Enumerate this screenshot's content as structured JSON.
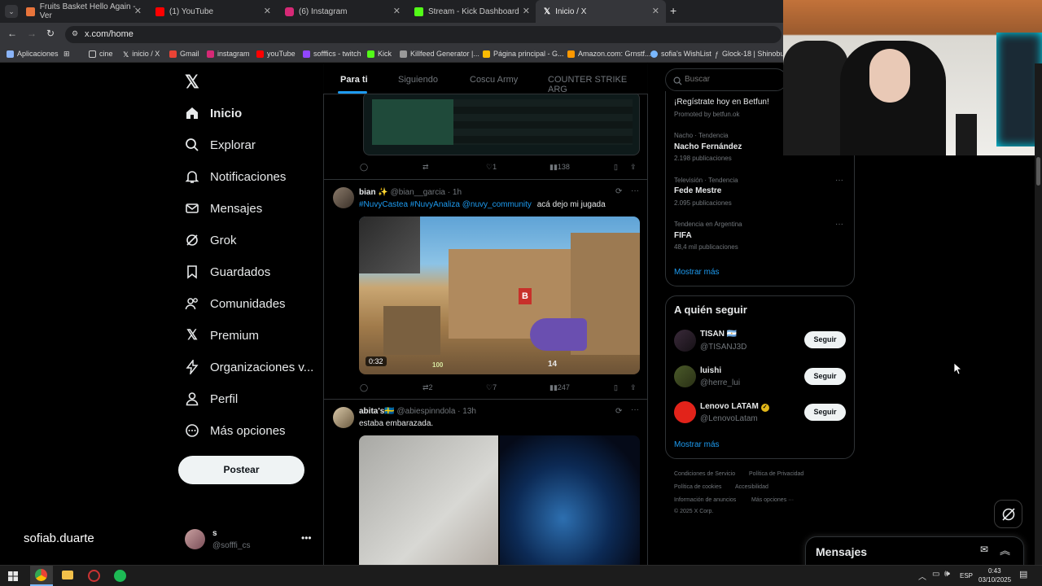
{
  "browser": {
    "tabs": [
      {
        "title": "Fruits Basket Hello Again - Ver",
        "color": "#e8743b"
      },
      {
        "title": "(1) YouTube",
        "color": "#ff0000"
      },
      {
        "title": "(6) Instagram",
        "color": "#d62976"
      },
      {
        "title": "Stream - Kick Dashboard",
        "color": "#53fc18"
      },
      {
        "title": "Inicio / X",
        "color": "#ffffff"
      }
    ],
    "url": "x.com/home",
    "bookmarks": [
      "Aplicaciones",
      "cine",
      "inicio / X",
      "Gmail",
      "instagram",
      "youTube",
      "sofffics - twitch",
      "Kick",
      "Killfeed Generator |...",
      "Página principal - G...",
      "Amazon.com: Grnstf...",
      "sofia's WishList",
      "Glock-18 | Shinobu..."
    ]
  },
  "sidebar": {
    "items": [
      {
        "label": "Inicio",
        "icon": "home-icon"
      },
      {
        "label": "Explorar",
        "icon": "search-icon"
      },
      {
        "label": "Notificaciones",
        "icon": "bell-icon"
      },
      {
        "label": "Mensajes",
        "icon": "mail-icon"
      },
      {
        "label": "Grok",
        "icon": "grok-icon"
      },
      {
        "label": "Guardados",
        "icon": "bookmark-icon"
      },
      {
        "label": "Comunidades",
        "icon": "people-icon"
      },
      {
        "label": "Premium",
        "icon": "x-icon"
      },
      {
        "label": "Organizaciones v...",
        "icon": "bolt-icon"
      },
      {
        "label": "Perfil",
        "icon": "person-icon"
      },
      {
        "label": "Más opciones",
        "icon": "more-circle-icon"
      }
    ],
    "post_label": "Postear",
    "account": {
      "name": "s",
      "handle": "@sofffi_cs"
    }
  },
  "overlay_name": "sofiab.duarte",
  "feed": {
    "tabs": [
      "Para ti",
      "Siguiendo",
      "Coscu Army",
      "COUNTER STRIKE ARG"
    ],
    "first_actions": {
      "likes": "1",
      "views": "138"
    },
    "tweets": [
      {
        "name": "bian ✨",
        "handle": "@bian__garcia",
        "time": "· 1h",
        "text_tags": "#NuvyCastea #NuvyAnaliza @nuvy_community",
        "text": "acá dejo mi jugada",
        "video_time": "0:32",
        "hud_health": "100",
        "hud_ammo": "14",
        "retweets": "2",
        "likes": "7",
        "views": "247"
      },
      {
        "name": "abita's🇸🇪",
        "handle": "@abiespinndola",
        "time": "· 13h",
        "text": "estaba embarazada."
      }
    ]
  },
  "search": {
    "placeholder": "Buscar"
  },
  "trends": {
    "promo": "¡Regístrate hoy en Betfun!",
    "promo_by": "Promoted by betfun.ok",
    "items": [
      {
        "meta": "Nacho · Tendencia",
        "name": "Nacho Fernández",
        "count": "2.198 publicaciones"
      },
      {
        "meta": "Televisión · Tendencia",
        "name": "Fede Mestre",
        "count": "2.095 publicaciones"
      },
      {
        "meta": "Tendencia en Argentina",
        "name": "FIFA",
        "count": "48,4 mil publicaciones"
      }
    ],
    "more": "Mostrar más"
  },
  "who_to_follow": {
    "title": "A quién seguir",
    "items": [
      {
        "name": "TISAN 🇦🇷",
        "handle": "@TISANJ3D",
        "button": "Seguir"
      },
      {
        "name": "luishi",
        "handle": "@herre_lui",
        "button": "Seguir"
      },
      {
        "name": "Lenovo LATAM",
        "handle": "@LenovoLatam",
        "button": "Seguir"
      }
    ],
    "more": "Mostrar más"
  },
  "footer": [
    "Condiciones de Servicio",
    "Política de Privacidad",
    "Política de cookies",
    "Accesibilidad",
    "Información de anuncios",
    "Más opciones ···",
    "© 2025 X Corp."
  ],
  "messages": {
    "title": "Mensajes"
  },
  "taskbar": {
    "lang": "ESP",
    "time": "0:43",
    "date": "03/10/2025"
  },
  "colors": {
    "x_blue": "#1d9bf0",
    "bg": "#000000",
    "muted": "#71767b"
  }
}
